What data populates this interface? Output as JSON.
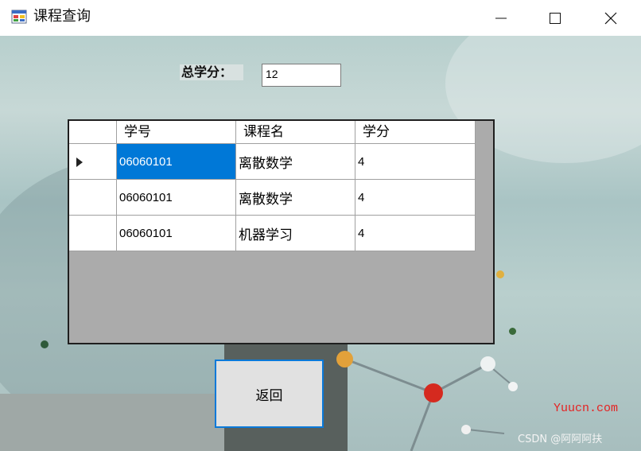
{
  "window": {
    "title": "课程查询"
  },
  "form": {
    "total_credits_label": "总学分：",
    "total_credits_value": "12"
  },
  "grid": {
    "columns": [
      "学号",
      "课程名",
      "学分"
    ],
    "rows": [
      {
        "student_id": "06060101",
        "course_name": "离散数学",
        "credits": "4"
      },
      {
        "student_id": "06060101",
        "course_name": "离散数学",
        "credits": "4"
      },
      {
        "student_id": "06060101",
        "course_name": "机器学习",
        "credits": "4"
      }
    ],
    "selected_row": 0
  },
  "buttons": {
    "back_label": "返回"
  },
  "watermarks": {
    "site": "Yuucn.com",
    "author": "CSDN @阿阿阿扶"
  },
  "colors": {
    "selection": "#0078d7",
    "button_border": "#0a79d9"
  }
}
